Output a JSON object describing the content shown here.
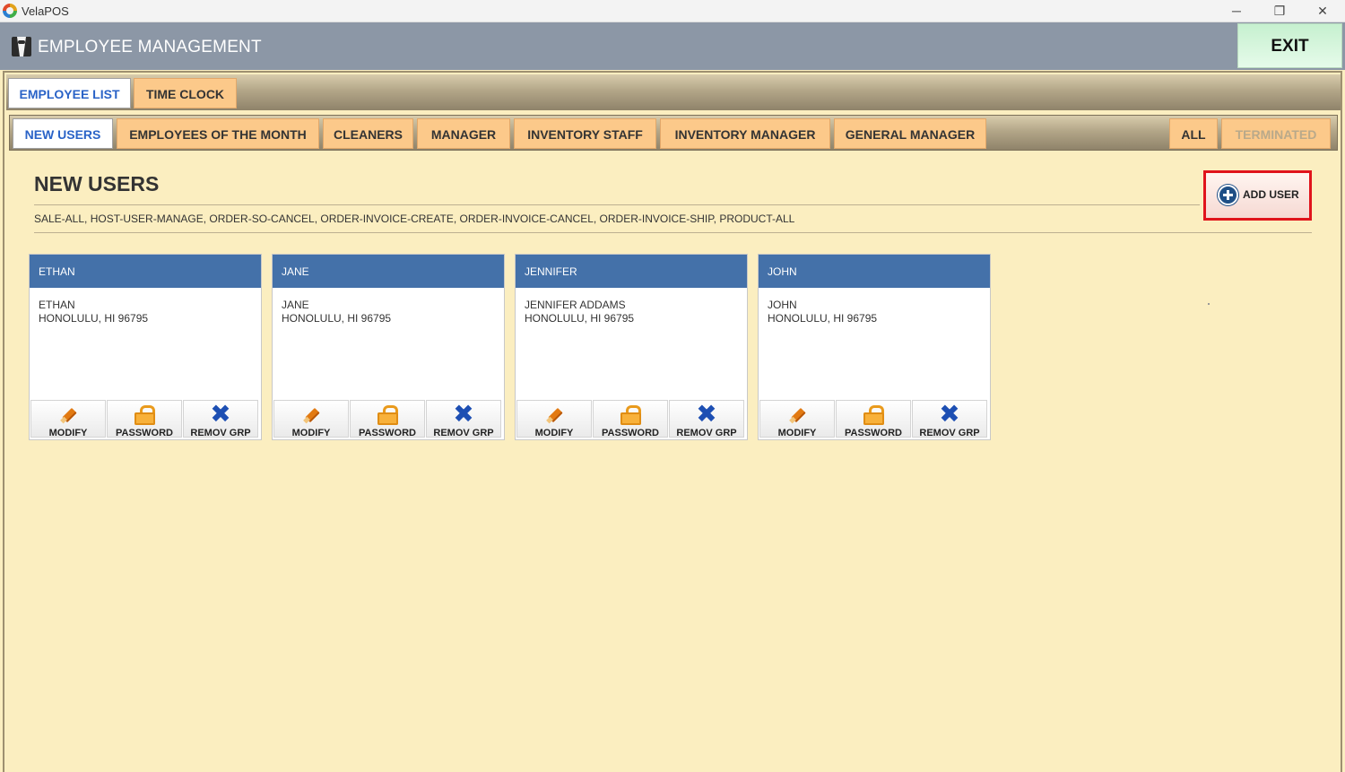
{
  "window": {
    "app_title": "VelaPOS",
    "minimize": "─",
    "maximize": "❐",
    "close": "✕"
  },
  "header": {
    "title": "EMPLOYEE MANAGEMENT",
    "exit_label": "EXIT"
  },
  "main_tabs": [
    {
      "label": "EMPLOYEE LIST",
      "active": true
    },
    {
      "label": "TIME CLOCK",
      "active": false
    }
  ],
  "group_tabs": [
    {
      "label": "NEW USERS",
      "active": true
    },
    {
      "label": "EMPLOYEES OF THE MONTH"
    },
    {
      "label": "CLEANERS"
    },
    {
      "label": "MANAGER"
    },
    {
      "label": "INVENTORY STAFF"
    },
    {
      "label": "INVENTORY MANAGER"
    },
    {
      "label": "GENERAL MANAGER"
    },
    {
      "label": "ALL"
    },
    {
      "label": "TERMINATED",
      "disabled": true
    }
  ],
  "section": {
    "title": "NEW USERS",
    "permissions": "SALE-ALL, HOST-USER-MANAGE, ORDER-SO-CANCEL, ORDER-INVOICE-CREATE, ORDER-INVOICE-CANCEL, ORDER-INVOICE-SHIP, PRODUCT-ALL",
    "add_user_label": "ADD USER"
  },
  "employees": [
    {
      "header": "ETHAN",
      "name": "ETHAN",
      "address": "HONOLULU, HI 96795"
    },
    {
      "header": "JANE",
      "name": "JANE",
      "address": "HONOLULU, HI 96795"
    },
    {
      "header": "JENNIFER",
      "name": "JENNIFER ADDAMS",
      "address": "HONOLULU, HI 96795"
    },
    {
      "header": "JOHN",
      "name": "JOHN",
      "address": "HONOLULU, HI 96795"
    }
  ],
  "card_actions": {
    "modify": "MODIFY",
    "password": "PASSWORD",
    "remove_group": "REMOV GRP"
  },
  "colors": {
    "background": "#fbeec0",
    "header": "#8c97a6",
    "exit_button": "#c6f0cf",
    "tab_inactive": "#fcc98a",
    "tab_active_text": "#2a63c7",
    "card_header": "#4471a9",
    "highlight_border": "#e0141c"
  }
}
